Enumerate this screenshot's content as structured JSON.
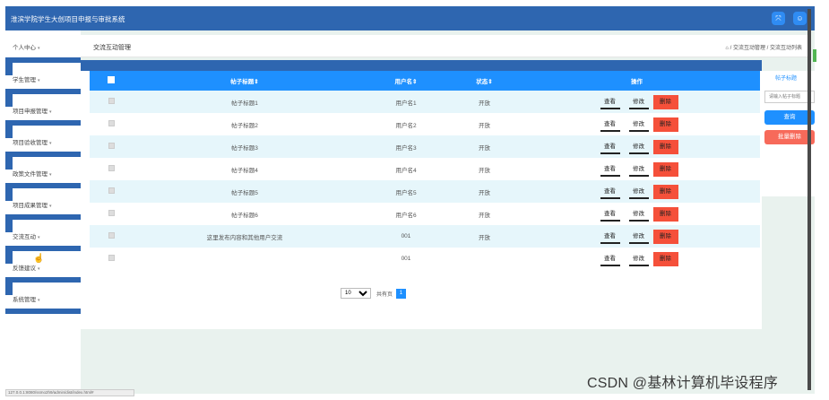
{
  "app": {
    "title": "淮滨学院学生大创项目申报与审批系统",
    "icons": [
      "expand-icon",
      "user-icon"
    ]
  },
  "sidebar": {
    "items": [
      {
        "label": "个人中心",
        "caret": "▾"
      },
      {
        "label": "学生管理",
        "caret": "▾"
      },
      {
        "label": "项目申报管理",
        "caret": "▾"
      },
      {
        "label": "项目验收管理",
        "caret": "▾"
      },
      {
        "label": "政策文件管理",
        "caret": "▾"
      },
      {
        "label": "项目成果管理",
        "caret": "▾"
      },
      {
        "label": "交流互动",
        "caret": "▾"
      },
      {
        "label": "反馈建议",
        "caret": "▾"
      },
      {
        "label": "系统管理",
        "caret": "▾"
      }
    ]
  },
  "breadcrumb": {
    "title": "交流互动管理",
    "path": "⌂ / 交流互动管理 / 交流互动列表"
  },
  "table": {
    "headers": [
      "帖子标题⇕",
      "用户名⇕",
      "状态⇕",
      "操作"
    ],
    "rows": [
      {
        "title": "帖子标题1",
        "user": "用户名1",
        "status": "开放"
      },
      {
        "title": "帖子标题2",
        "user": "用户名2",
        "status": "开放"
      },
      {
        "title": "帖子标题3",
        "user": "用户名3",
        "status": "开放"
      },
      {
        "title": "帖子标题4",
        "user": "用户名4",
        "status": "开放"
      },
      {
        "title": "帖子标题5",
        "user": "用户名5",
        "status": "开放"
      },
      {
        "title": "帖子标题6",
        "user": "用户名6",
        "status": "开放"
      },
      {
        "title": "这里发布内容和其他用户交流",
        "user": "001",
        "status": "开放"
      },
      {
        "title": "",
        "user": "001",
        "status": ""
      }
    ],
    "actions": {
      "view": "查看",
      "edit": "修改",
      "delete": "删除"
    }
  },
  "pagination": {
    "page_size": "10",
    "total_text": "共有页",
    "current_page": "1"
  },
  "search_panel": {
    "label": "帖子标题",
    "placeholder": "请输入帖子标题",
    "query_button": "查询",
    "batch_delete_button": "批量删除"
  },
  "watermark": "CSDN @基林计算机毕设程序",
  "status_url": "127.0.0.1:8080/ssmo2h9/admin/dist/index.html#",
  "colors": {
    "topbar": "#2e66b0",
    "header_blue": "#1e90ff",
    "row_alt": "#e6f6fb",
    "delete_red": "#f5503a",
    "batch_delete": "#f76a5a"
  }
}
